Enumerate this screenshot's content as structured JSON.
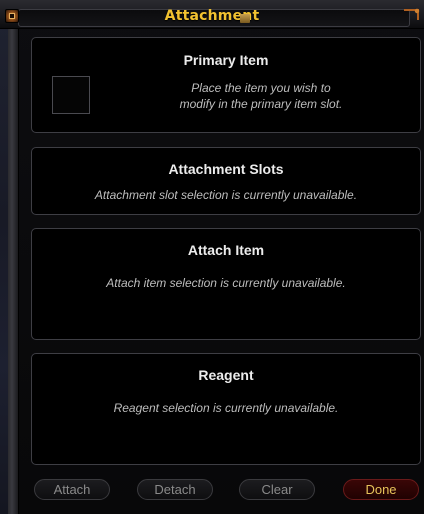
{
  "window": {
    "title": "Attachment"
  },
  "primary_item": {
    "title": "Primary Item",
    "note_line1": "Place the item you wish to",
    "note_line2": "modify in the primary item slot."
  },
  "attachment_slots": {
    "title": "Attachment Slots",
    "note": "Attachment slot selection is currently unavailable."
  },
  "attach_item": {
    "title": "Attach Item",
    "note": "Attach item selection is currently unavailable."
  },
  "reagent": {
    "title": "Reagent",
    "note": "Reagent selection is currently unavailable."
  },
  "buttons": {
    "attach": "Attach",
    "detach": "Detach",
    "clear": "Clear",
    "done": "Done"
  },
  "colors": {
    "title_gold": "#f2c230",
    "done_text": "#e6c25a",
    "done_bg": "#2a0303"
  }
}
